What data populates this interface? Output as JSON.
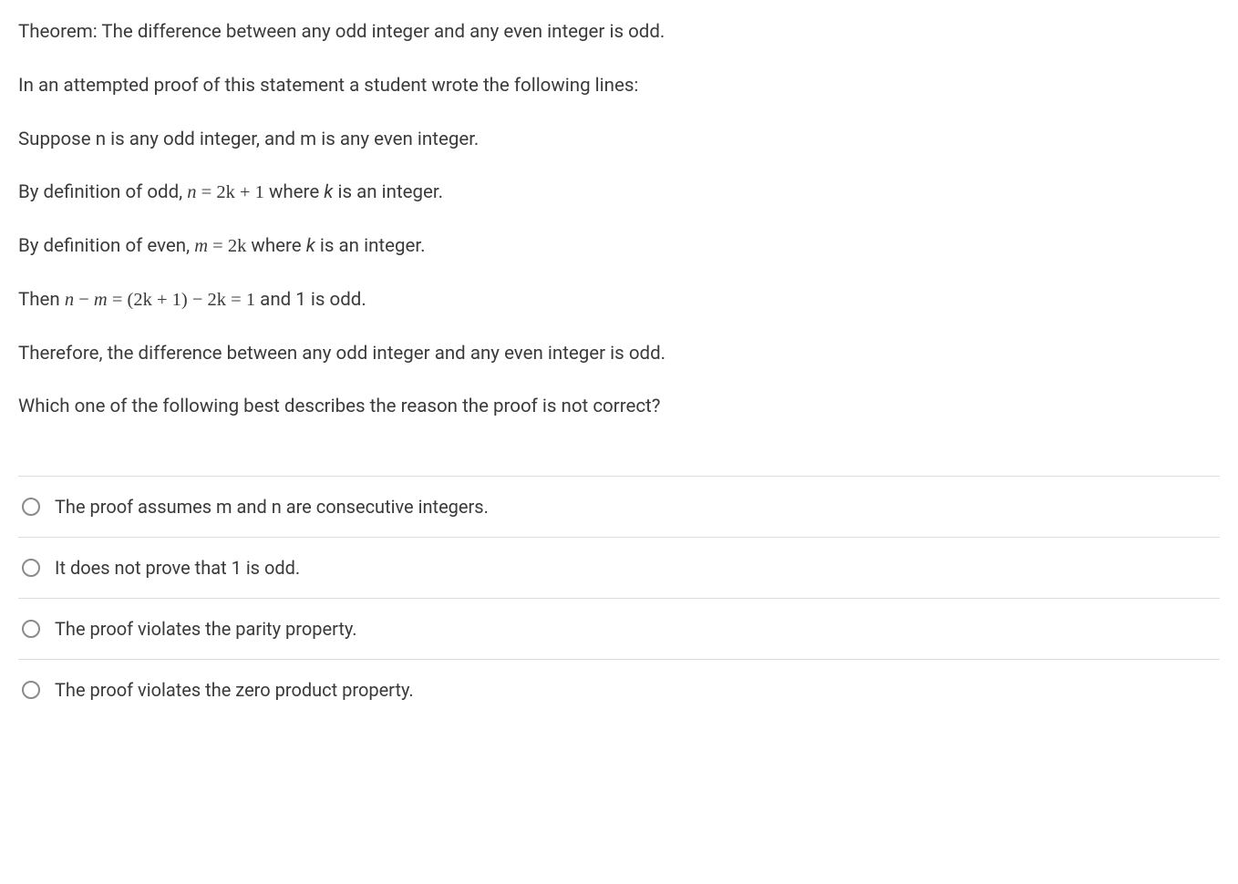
{
  "question": {
    "p1": "Theorem: The difference between any odd integer and any even integer is odd.",
    "p2": "In an attempted proof of this statement a student wrote the following lines:",
    "p3": "Suppose n is any odd integer, and m is any even integer.",
    "p4_prefix": "By definition of odd, ",
    "p4_math_n": "n",
    "p4_math_eq": " = ",
    "p4_math_rhs": "2k + 1",
    "p4_suffix_a": " where ",
    "p4_suffix_k": "k",
    "p4_suffix_b": " is an integer.",
    "p5_prefix": "By definition of even, ",
    "p5_math_m": "m",
    "p5_math_eq": " = ",
    "p5_math_rhs": "2k",
    "p5_suffix_a": " where ",
    "p5_suffix_k": "k",
    "p5_suffix_b": " is an integer.",
    "p6_prefix": "Then ",
    "p6_math_n": "n",
    "p6_math_minus": " − ",
    "p6_math_m": "m",
    "p6_math_eq1": " = ",
    "p6_math_paren": "(2k + 1) − 2k",
    "p6_math_eq2": " = ",
    "p6_math_one": "1",
    "p6_suffix": " and 1 is odd.",
    "p7": "Therefore, the difference between any odd integer and any even integer is odd.",
    "p8": "Which one of the following best describes the reason the proof is not correct?"
  },
  "options": {
    "a": "The proof assumes m and n are consecutive integers.",
    "b": "It does not prove that 1 is odd.",
    "c": "The proof violates the parity property.",
    "d": "The proof violates the zero product property."
  }
}
